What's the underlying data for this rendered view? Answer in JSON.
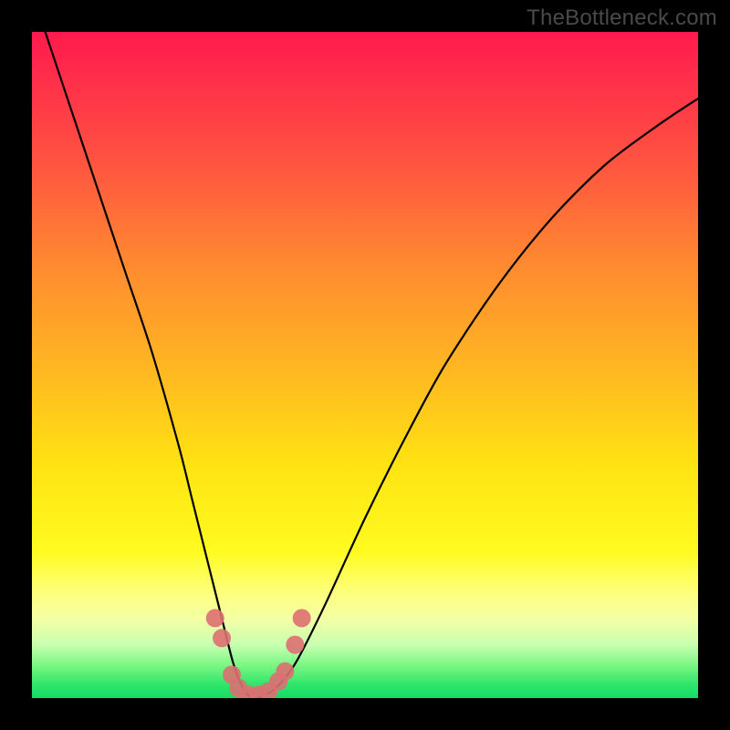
{
  "watermark": "TheBottleneck.com",
  "chart_data": {
    "type": "line",
    "title": "",
    "xlabel": "",
    "ylabel": "",
    "xlim": [
      0,
      100
    ],
    "ylim": [
      0,
      100
    ],
    "series": [
      {
        "name": "bottleneck-curve",
        "x": [
          2,
          6,
          10,
          14,
          18,
          22,
          24,
          26,
          28,
          30,
          31,
          32,
          33,
          34,
          36,
          38,
          40,
          44,
          50,
          56,
          62,
          70,
          78,
          86,
          94,
          100
        ],
        "values": [
          100,
          88,
          76,
          64,
          52,
          38,
          30,
          22,
          14,
          6,
          3,
          1,
          0,
          0,
          1,
          3,
          6,
          14,
          27,
          39,
          50,
          62,
          72,
          80,
          86,
          90
        ]
      }
    ],
    "markers": {
      "name": "highlight-dots",
      "color": "#dd6f72",
      "points": [
        {
          "x": 27.5,
          "y": 12
        },
        {
          "x": 28.5,
          "y": 9
        },
        {
          "x": 30.0,
          "y": 3.5
        },
        {
          "x": 31.0,
          "y": 1.5
        },
        {
          "x": 32.5,
          "y": 0.5
        },
        {
          "x": 34.0,
          "y": 0.5
        },
        {
          "x": 35.5,
          "y": 1.0
        },
        {
          "x": 37.0,
          "y": 2.5
        },
        {
          "x": 38.0,
          "y": 4.0
        },
        {
          "x": 39.5,
          "y": 8.0
        },
        {
          "x": 40.5,
          "y": 12.0
        }
      ]
    }
  }
}
